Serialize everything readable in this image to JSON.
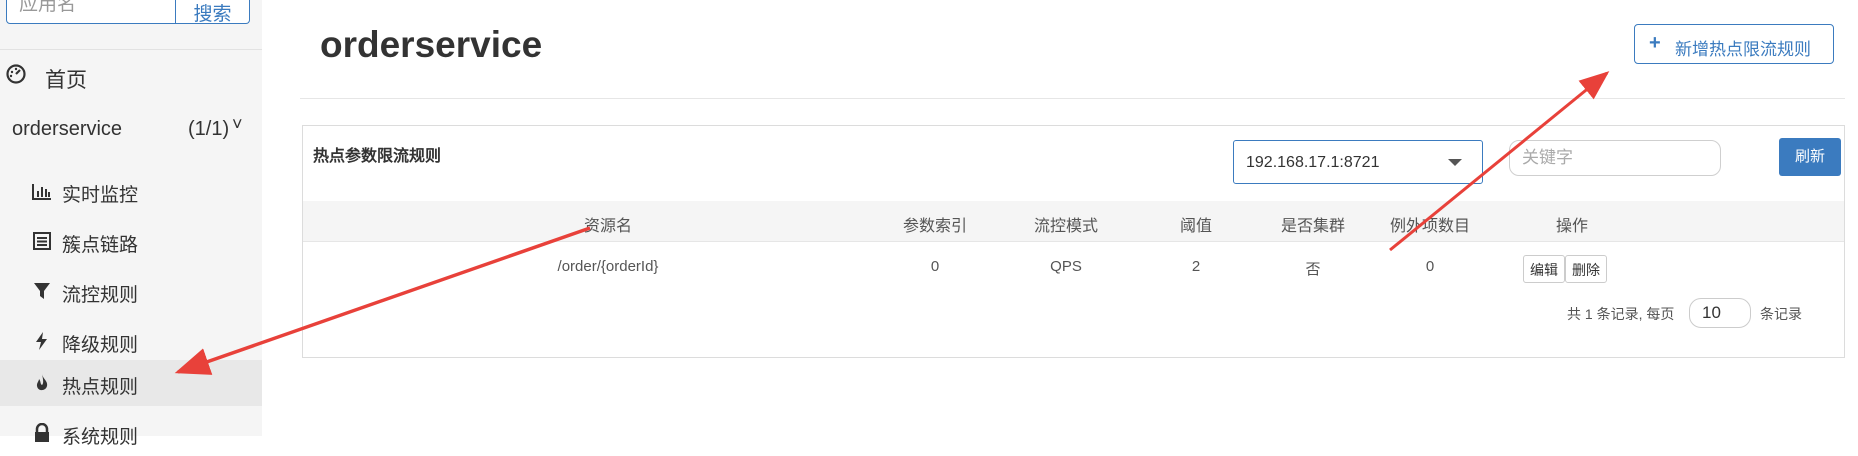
{
  "sidebar": {
    "search": {
      "placeholder": "应用名",
      "button_label": "搜索"
    },
    "home_label": "首页",
    "app": {
      "name": "orderservice",
      "count": "(1/1)",
      "chevron": "˅"
    },
    "items": [
      {
        "icon": "bar-chart-icon",
        "label": "实时监控"
      },
      {
        "icon": "list-icon",
        "label": "簇点链路"
      },
      {
        "icon": "filter-icon",
        "label": "流控规则"
      },
      {
        "icon": "bolt-icon",
        "label": "降级规则"
      },
      {
        "icon": "fire-icon",
        "label": "热点规则",
        "active": true
      },
      {
        "icon": "lock-icon",
        "label": "系统规则"
      }
    ]
  },
  "header": {
    "title": "orderservice",
    "add_button_label": "新增热点限流规则",
    "add_button_icon": "+"
  },
  "panel": {
    "title": "热点参数限流规则",
    "machine": "192.168.17.1:8721",
    "keyword_placeholder": "关键字",
    "refresh_label": "刷新",
    "columns": [
      "资源名",
      "参数索引",
      "流控模式",
      "阈值",
      "是否集群",
      "例外项数目",
      "操作"
    ],
    "rows": [
      {
        "resource": "/order/{orderId}",
        "param_index": "0",
        "mode": "QPS",
        "threshold": "2",
        "cluster": "否",
        "exceptions": "0",
        "edit": "编辑",
        "delete": "删除"
      }
    ],
    "pagination": {
      "prefix": "共 1 条记录, 每页",
      "page_size": "10",
      "suffix": "条记录"
    }
  },
  "colors": {
    "accent": "#3b7bbf",
    "arrow": "#e8413a"
  }
}
